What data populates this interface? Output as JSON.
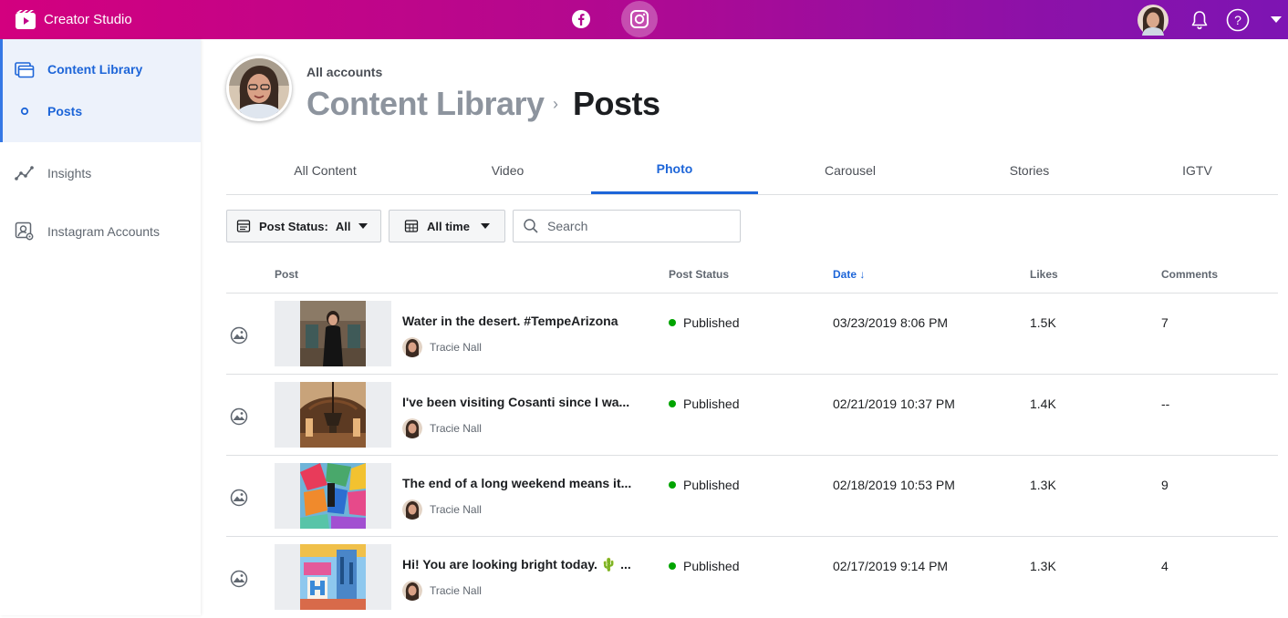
{
  "app": {
    "name": "Creator Studio"
  },
  "topbar": {
    "platforms": [
      {
        "name": "facebook-icon"
      },
      {
        "name": "instagram-icon"
      }
    ],
    "icons": [
      "bell-icon",
      "help-icon",
      "caret-down-icon"
    ]
  },
  "sidebar": {
    "items": [
      {
        "label": "Content Library",
        "icon": "content-library-icon"
      },
      {
        "label": "Posts",
        "icon": "circle-icon"
      },
      {
        "label": "Insights",
        "icon": "insights-icon"
      },
      {
        "label": "Instagram Accounts",
        "icon": "instagram-accounts-icon"
      }
    ]
  },
  "header": {
    "accounts_label": "All accounts",
    "breadcrumb_parent": "Content Library",
    "breadcrumb_separator": "›",
    "breadcrumb_current": "Posts"
  },
  "tabs": [
    {
      "label": "All Content"
    },
    {
      "label": "Video"
    },
    {
      "label": "Photo"
    },
    {
      "label": "Carousel"
    },
    {
      "label": "Stories"
    },
    {
      "label": "IGTV"
    }
  ],
  "active_tab": "Photo",
  "filters": {
    "post_status_label": "Post Status:",
    "post_status_value": "All",
    "time_value": "All time",
    "search_placeholder": "Search"
  },
  "table": {
    "columns": {
      "post": "Post",
      "post_status": "Post Status",
      "date": "Date ↓",
      "likes": "Likes",
      "comments": "Comments"
    },
    "rows": [
      {
        "title": "Water in the desert. #TempeArizona",
        "author": "Tracie Nall",
        "status": "Published",
        "date": "03/23/2019 8:06 PM",
        "likes": "1.5K",
        "comments": "7"
      },
      {
        "title": "I've been visiting Cosanti since I wa...",
        "author": "Tracie Nall",
        "status": "Published",
        "date": "02/21/2019 10:37 PM",
        "likes": "1.4K",
        "comments": "--"
      },
      {
        "title": "The end of a long weekend means it...",
        "author": "Tracie Nall",
        "status": "Published",
        "date": "02/18/2019 10:53 PM",
        "likes": "1.3K",
        "comments": "9"
      },
      {
        "title": "Hi! You are looking bright today. 🌵 ...",
        "author": "Tracie Nall",
        "status": "Published",
        "date": "02/17/2019 9:14 PM",
        "likes": "1.3K",
        "comments": "4"
      }
    ]
  },
  "colors": {
    "accent": "#1d65d8",
    "published": "#00a400",
    "topbar_start": "#d3007f",
    "topbar_end": "#7d14b3"
  }
}
